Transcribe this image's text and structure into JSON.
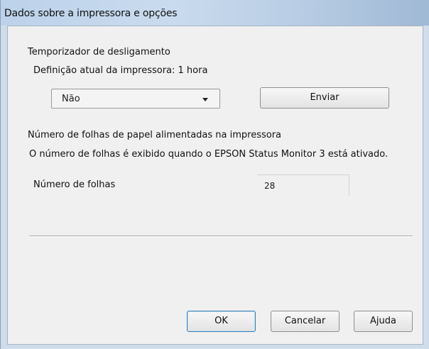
{
  "window": {
    "title": "Dados sobre a impressora e opções"
  },
  "shutdown_timer": {
    "group_label": "Temporizador de desligamento",
    "current_setting": "Definição atual da impressora: 1 hora",
    "select_value": "Não",
    "send_label": "Enviar"
  },
  "sheets": {
    "group_label": "Número de folhas de papel alimentadas na impressora",
    "info_text": "O número de folhas é exibido quando o EPSON Status Monitor 3 está ativado.",
    "count_label": "Número de folhas",
    "count_value": "28"
  },
  "footer": {
    "ok_label": "OK",
    "cancel_label": "Cancelar",
    "help_label": "Ajuda"
  }
}
